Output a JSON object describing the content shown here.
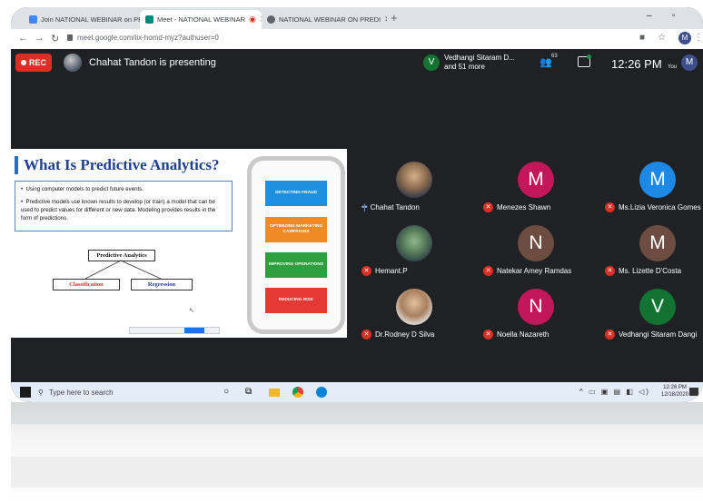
{
  "browser": {
    "tabs": [
      {
        "label": "Join NATIONAL WEBINAR on PE",
        "active": false,
        "color": "#4285f4"
      },
      {
        "label": "Meet - NATIONAL WEBINAR",
        "active": true,
        "color": "#00897b"
      },
      {
        "label": "NATIONAL WEBINAR ON PREDI",
        "active": false,
        "color": "#5f6368"
      }
    ],
    "url": "meet.google.com/iix-homd-myz?authuser=0",
    "profile_initial": "M"
  },
  "meet": {
    "rec_label": "REC",
    "presenting_text": "Chahat Tandon is presenting",
    "participants_avatar": "V",
    "participants_line1": "Vedhangi Sitaram D...",
    "participants_line2": "and 51 more",
    "people_count": "63",
    "time": "12:26 PM",
    "you_initial": "M",
    "you_label": "You"
  },
  "slide": {
    "title": "What Is Predictive Analytics?",
    "bullets": [
      "Using computer models to predict future events.",
      "Predictive models use known results to develop (or train) a model that can be used to predict values for different or new data. Modeling provides results in the form of predictions."
    ],
    "tree_root": "Predictive Analytics",
    "tree_left": "Classification",
    "tree_right": "Regression",
    "panel_buttons": [
      {
        "label": "DETECTING FRAUD",
        "color": "#1e90e0"
      },
      {
        "label": "OPTIMIZING MARKETING CAMPAIGNS",
        "color": "#f08a24"
      },
      {
        "label": "IMPROVING OPERATIONS",
        "color": "#2e9e3e"
      },
      {
        "label": "REDUCING RISK",
        "color": "#e53935"
      }
    ]
  },
  "participants": [
    {
      "name": "Chahat Tandon",
      "initial": "",
      "color": "",
      "photo": "photo",
      "muted": false
    },
    {
      "name": "Menezes Shawn",
      "initial": "M",
      "color": "#c2185b",
      "photo": "",
      "muted": true
    },
    {
      "name": "Ms.Lizia Veronica Gomes",
      "initial": "M",
      "color": "#1e88e5",
      "photo": "",
      "muted": true
    },
    {
      "name": "Hemant.P",
      "initial": "",
      "color": "",
      "photo": "photo2",
      "muted": true
    },
    {
      "name": "Natekar Amey Ramdas",
      "initial": "N",
      "color": "#6d4c41",
      "photo": "",
      "muted": true
    },
    {
      "name": "Ms. Lizette D'Costa",
      "initial": "M",
      "color": "#6d4c41",
      "photo": "",
      "muted": true
    },
    {
      "name": "Dr.Rodney D Silva",
      "initial": "",
      "color": "",
      "photo": "photo3",
      "muted": true
    },
    {
      "name": "Noella Nazareth",
      "initial": "N",
      "color": "#c2185b",
      "photo": "",
      "muted": true
    },
    {
      "name": "Vedhangi Sitaram Dangi",
      "initial": "V",
      "color": "#137333",
      "photo": "",
      "muted": true
    }
  ],
  "taskbar": {
    "search_placeholder": "Type here to search",
    "time": "12:26 PM",
    "date": "12/18/2020"
  }
}
